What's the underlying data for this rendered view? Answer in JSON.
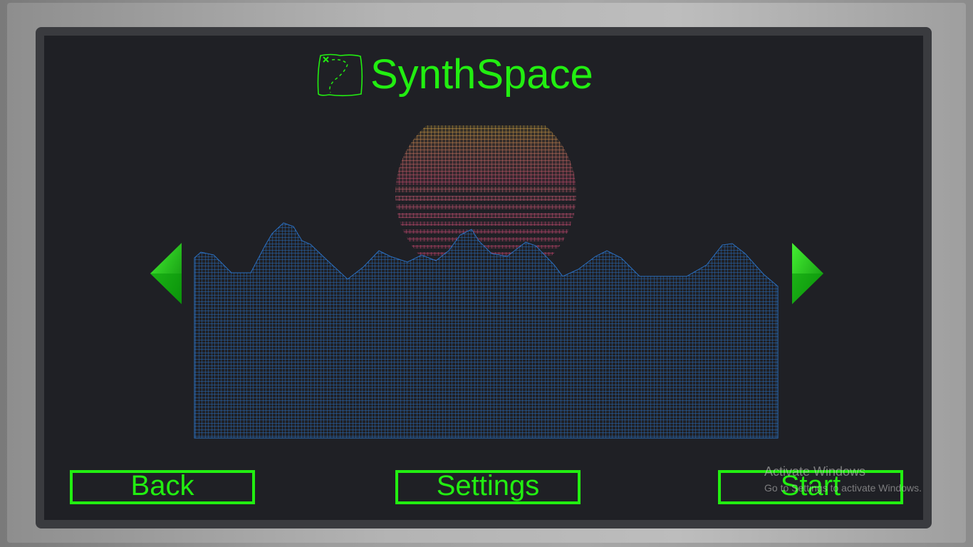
{
  "game": {
    "title": "SynthSpace",
    "logo_icon": "treasure-map-icon",
    "accent_color": "#22ee11",
    "prev_arrow_icon": "left-arrow-icon",
    "next_arrow_icon": "right-arrow-icon"
  },
  "buttons": {
    "back": "Back",
    "settings": "Settings",
    "start": "Start"
  },
  "watermark": {
    "line1": "Activate Windows",
    "line2": "Go to Settings to activate Windows."
  }
}
